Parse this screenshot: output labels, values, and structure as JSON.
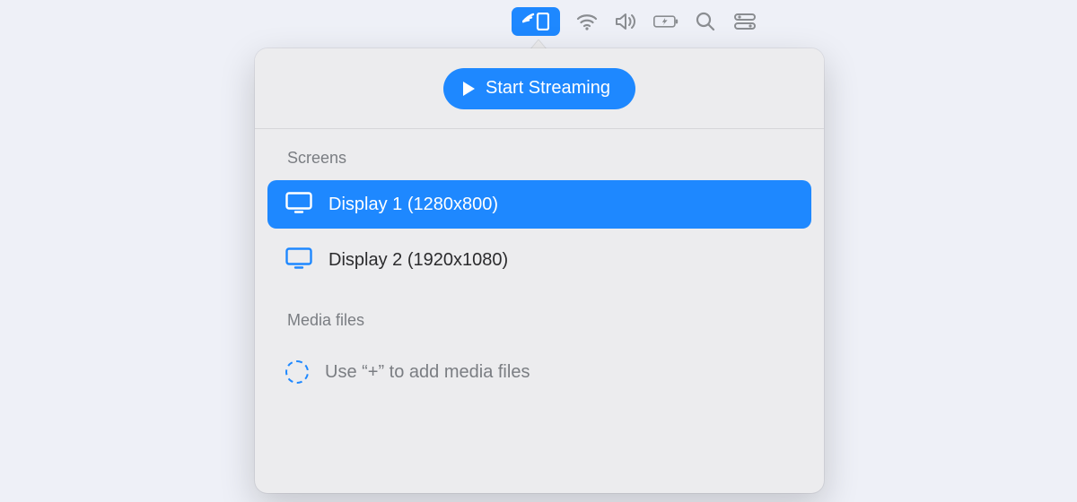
{
  "menubar": {
    "active_icon": "cast",
    "icons": [
      "cast",
      "wifi",
      "volume",
      "battery",
      "search",
      "control-center"
    ]
  },
  "popover": {
    "start_label": "Start Streaming",
    "screens_label": "Screens",
    "screens": [
      {
        "label": "Display 1 (1280x800)",
        "selected": true
      },
      {
        "label": "Display 2 (1920x1080)",
        "selected": false
      }
    ],
    "media_label": "Media files",
    "media_placeholder": "Use “+” to add media files"
  },
  "colors": {
    "accent": "#1e88ff",
    "panel_bg": "#ececee",
    "page_bg": "#eef0f7",
    "muted_text": "#7a7d82"
  }
}
